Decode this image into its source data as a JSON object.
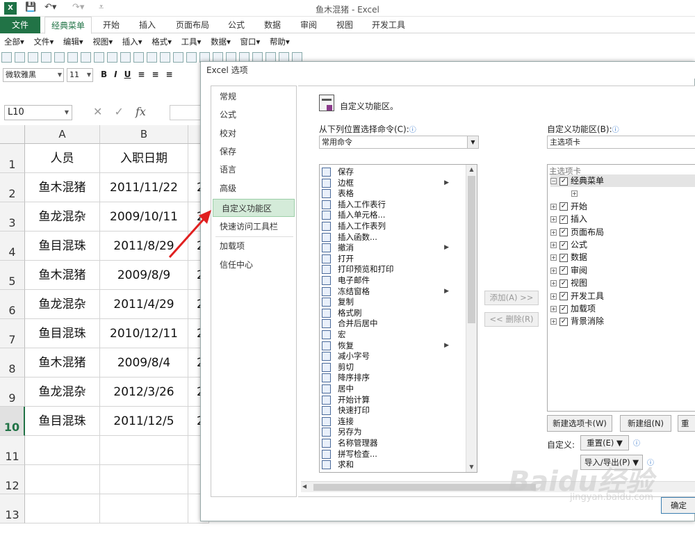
{
  "window": {
    "title": "鱼木混猪 - Excel",
    "logo": "X"
  },
  "ribbon_tabs": [
    {
      "label": "文件"
    },
    {
      "label": "经典菜单"
    },
    {
      "label": "开始"
    },
    {
      "label": "插入"
    },
    {
      "label": "页面布局"
    },
    {
      "label": "公式"
    },
    {
      "label": "数据"
    },
    {
      "label": "审阅"
    },
    {
      "label": "视图"
    },
    {
      "label": "开发工具"
    }
  ],
  "classic_menus": [
    "全部",
    "文件",
    "编辑",
    "视图",
    "插入",
    "格式",
    "工具",
    "数据",
    "窗口",
    "帮助"
  ],
  "font": {
    "name": "微软雅黑",
    "size": "11"
  },
  "formula_bar": {
    "name_box": "L10",
    "fx": "fx"
  },
  "sheet": {
    "columns": [
      "A",
      "B"
    ],
    "row_numbers": [
      "1",
      "2",
      "3",
      "4",
      "5",
      "6",
      "7",
      "8",
      "9",
      "10",
      "11",
      "12",
      "13"
    ],
    "selected_row": "10",
    "rows": [
      [
        "人员",
        "入职日期"
      ],
      [
        "鱼木混猪",
        "2011/11/22"
      ],
      [
        "鱼龙混杂",
        "2009/10/11"
      ],
      [
        "鱼目混珠",
        "2011/8/29"
      ],
      [
        "鱼木混猪",
        "2009/8/9"
      ],
      [
        "鱼龙混杂",
        "2011/4/29"
      ],
      [
        "鱼目混珠",
        "2010/12/11"
      ],
      [
        "鱼木混猪",
        "2009/8/4"
      ],
      [
        "鱼龙混杂",
        "2012/3/26"
      ],
      [
        "鱼目混珠",
        "2011/12/5"
      ],
      [
        "",
        ""
      ],
      [
        "",
        ""
      ],
      [
        "",
        ""
      ]
    ],
    "peek_char": "2"
  },
  "dialog": {
    "title": "Excel 选项",
    "nav": [
      {
        "label": "常规"
      },
      {
        "label": "公式"
      },
      {
        "label": "校对"
      },
      {
        "label": "保存"
      },
      {
        "label": "语言"
      },
      {
        "label": "高级"
      },
      {
        "label": "自定义功能区"
      },
      {
        "label": "快速访问工具栏"
      },
      {
        "label": "加载项"
      },
      {
        "label": "信任中心"
      }
    ],
    "selected_nav": "自定义功能区",
    "heading": "自定义功能区。",
    "choose_label": "从下列位置选择命令(C):",
    "choose_value": "常用命令",
    "customize_label": "自定义功能区(B):",
    "customize_value": "主选项卡",
    "commands": [
      {
        "label": "保存",
        "sub": false
      },
      {
        "label": "边框",
        "sub": true
      },
      {
        "label": "表格",
        "sub": false
      },
      {
        "label": "插入工作表行",
        "sub": false
      },
      {
        "label": "插入单元格...",
        "sub": false
      },
      {
        "label": "插入工作表列",
        "sub": false
      },
      {
        "label": "插入函数...",
        "sub": false
      },
      {
        "label": "撤消",
        "sub": true
      },
      {
        "label": "打开",
        "sub": false
      },
      {
        "label": "打印预览和打印",
        "sub": false
      },
      {
        "label": "电子邮件",
        "sub": false
      },
      {
        "label": "冻结窗格",
        "sub": true
      },
      {
        "label": "复制",
        "sub": false
      },
      {
        "label": "格式刷",
        "sub": false
      },
      {
        "label": "合并后居中",
        "sub": false
      },
      {
        "label": "宏",
        "sub": false
      },
      {
        "label": "恢复",
        "sub": true
      },
      {
        "label": "减小字号",
        "sub": false
      },
      {
        "label": "剪切",
        "sub": false
      },
      {
        "label": "降序排序",
        "sub": false
      },
      {
        "label": "居中",
        "sub": false
      },
      {
        "label": "开始计算",
        "sub": false
      },
      {
        "label": "快速打印",
        "sub": false
      },
      {
        "label": "连接",
        "sub": false
      },
      {
        "label": "另存为",
        "sub": false
      },
      {
        "label": "名称管理器",
        "sub": false
      },
      {
        "label": "拼写检查...",
        "sub": false
      },
      {
        "label": "求和",
        "sub": false
      }
    ],
    "add_button": "添加(A) >>",
    "remove_button": "<< 删除(R)",
    "tree_header": "主选项卡",
    "tree": [
      {
        "label": "经典菜单",
        "expanded": true,
        "checked": true,
        "level": 0
      },
      {
        "label": "",
        "expanded": false,
        "checked": false,
        "level": 1
      },
      {
        "label": "开始",
        "expanded": false,
        "checked": true,
        "level": 0
      },
      {
        "label": "插入",
        "expanded": false,
        "checked": true,
        "level": 0
      },
      {
        "label": "页面布局",
        "expanded": false,
        "checked": true,
        "level": 0
      },
      {
        "label": "公式",
        "expanded": false,
        "checked": true,
        "level": 0
      },
      {
        "label": "数据",
        "expanded": false,
        "checked": true,
        "level": 0
      },
      {
        "label": "审阅",
        "expanded": false,
        "checked": true,
        "level": 0
      },
      {
        "label": "视图",
        "expanded": false,
        "checked": true,
        "level": 0
      },
      {
        "label": "开发工具",
        "expanded": false,
        "checked": true,
        "level": 0
      },
      {
        "label": "加载项",
        "expanded": false,
        "checked": true,
        "level": 0
      },
      {
        "label": "背景消除",
        "expanded": false,
        "checked": true,
        "level": 0
      }
    ],
    "new_tab_button": "新建选项卡(W)",
    "new_group_button": "新建组(N)",
    "rename_button": "重命",
    "customize_text": "自定义:",
    "reset_button": "重置(E) ▼",
    "import_export_button": "导入/导出(P) ▼",
    "ok_button": "确定"
  },
  "watermark": {
    "text": "Baidu经验",
    "url": "jingyan.baidu.com"
  },
  "colors": {
    "excel_green": "#217346",
    "nav_selected": "#d4ebd9",
    "arrow": "#e02020"
  }
}
